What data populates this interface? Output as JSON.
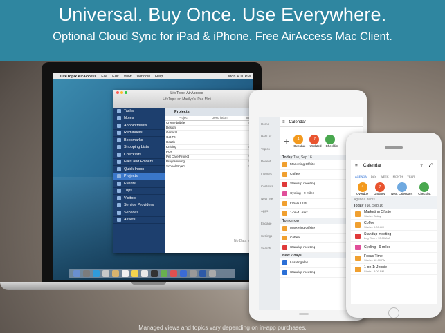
{
  "banner": {
    "title": "Universal. Buy Once. Use Everywhere.",
    "subtitle": "Optional Cloud Sync for iPad & iPhone. Free AirAccess Mac Client."
  },
  "footnote": "Managed views and topics vary depending on in-app purchases.",
  "mac": {
    "menubar": {
      "app": "LifeTopix AirAccess",
      "items": [
        "File",
        "Edit",
        "View",
        "Window",
        "Help"
      ],
      "clock": "Mon 4:11 PM"
    },
    "window": {
      "title": "LifeTopix AirAccess",
      "subtitle": "LifeTopix on Marilyn's iPad Mini",
      "sidebar": [
        "Tasks",
        "Notes",
        "Appointments",
        "Reminders",
        "Bookmarks",
        "Shopping Lists",
        "Checklists",
        "Files and Folders",
        "Quick Inbox",
        "Projects",
        "Events",
        "Trips",
        "Visitors",
        "Service Providers",
        "Services",
        "Assets"
      ],
      "selected": "Projects",
      "main_title": "Projects",
      "columns": [
        "Project",
        "Description",
        "Ma"
      ],
      "rows": [
        [
          "Creme brûlée",
          "",
          "Ma"
        ],
        [
          "Design",
          "",
          ""
        ],
        [
          "General",
          "",
          ""
        ],
        [
          "Get Fit",
          "",
          ""
        ],
        [
          "Health",
          "",
          ""
        ],
        [
          "Knitting",
          "",
          "Ma"
        ],
        [
          "POF",
          "",
          ""
        ],
        [
          "Pet Care Project",
          "",
          "Fel"
        ],
        [
          "Programming",
          "",
          "Fel"
        ],
        [
          "SchoolProject",
          "",
          "Fel"
        ]
      ],
      "nodata": "No Data to"
    }
  },
  "ipad": {
    "title": "Calendar",
    "side": [
      "Home",
      "Hot List",
      "Topics",
      "Recent",
      "Inboxes",
      "Contexts",
      "Near Me",
      "Apps",
      "Engage",
      "Settings",
      "Search"
    ],
    "badges": [
      {
        "label": "Overdue",
        "n": "4"
      },
      {
        "label": "Undated",
        "n": "7"
      },
      {
        "label": "Checklist",
        "n": ""
      }
    ],
    "today_label": "Today",
    "today_date": "Tue, Sep 16",
    "today": [
      "Marketing Offsite",
      "Coffee",
      "Standup meeting",
      "Cycling - 9 miles",
      "Focus Time",
      "1-on-1: Alex"
    ],
    "tomorrow_label": "Tomorrow",
    "tomorrow": [
      "Marketing Offsite",
      "Coffee",
      "Standup meeting"
    ],
    "next_label": "Next 7 days",
    "next": [
      "Los Angeles",
      "Standup meeting"
    ]
  },
  "iphone": {
    "title": "Calendar",
    "tabs": [
      "AGENDA",
      "DAY",
      "WEEK",
      "MONTH",
      "YEAR"
    ],
    "badges": [
      {
        "label": "Overdue",
        "n": "4"
      },
      {
        "label": "Undated",
        "n": "7"
      },
      {
        "label": "Next Calendars",
        "n": ""
      },
      {
        "label": "Checklist",
        "n": ""
      }
    ],
    "section": "Agenda Items",
    "today_label": "Today",
    "today_date": "Tue, Sep 16",
    "items": [
      {
        "t": "Marketing Offsite",
        "s": "Starts - Today",
        "c": "#f0a030"
      },
      {
        "t": "Coffee",
        "s": "Starts - 9:00 AM",
        "c": "#f0a030"
      },
      {
        "t": "Standup meeting",
        "s": "Log Time - 10:00 AM",
        "c": "#e03a3a"
      },
      {
        "t": "Cycling - 9 miles",
        "s": "",
        "c": "#e04f9a"
      },
      {
        "t": "Focus Time",
        "s": "Starts - 12:00 PM",
        "c": "#f0a030"
      },
      {
        "t": "1-on-1: Jennie",
        "s": "Starts - 3:00 PM",
        "c": "#f0a030"
      }
    ]
  }
}
